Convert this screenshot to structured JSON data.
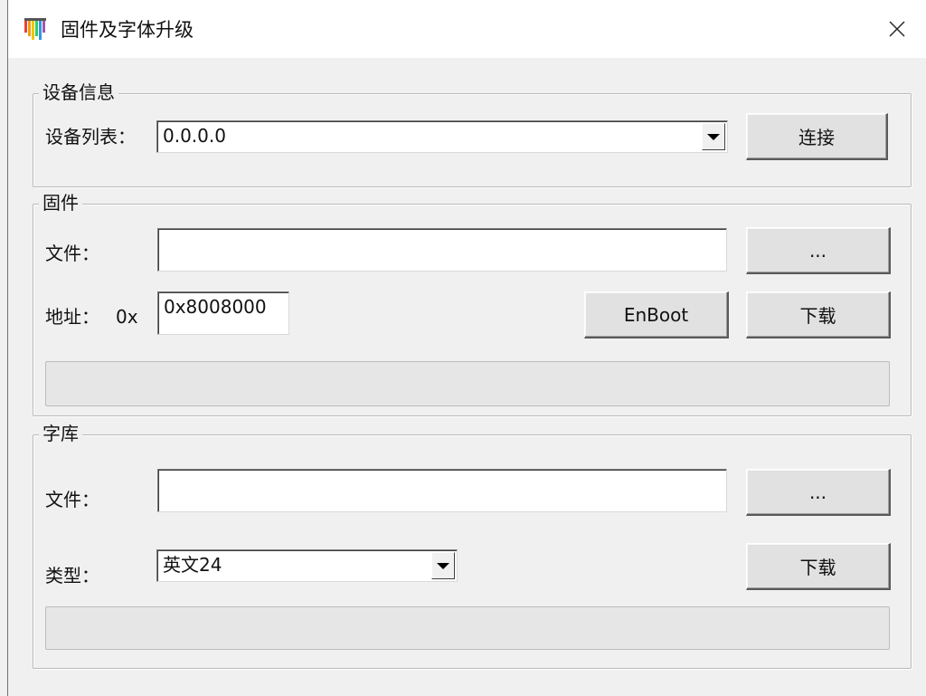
{
  "window": {
    "title": "固件及字体升级",
    "close_symbol": "×"
  },
  "device_info": {
    "legend": "设备信息",
    "list_label": "设备列表：",
    "selected_device": "0.0.0.0",
    "connect_label": "连接"
  },
  "firmware": {
    "legend": "固件",
    "file_label": "文件：",
    "file_value": "",
    "browse_label": "...",
    "address_label": "地址：",
    "address_prefix": "0x",
    "address_value": "0x8008000",
    "enboot_label": "EnBoot",
    "download_label": "下载",
    "progress": 0
  },
  "font_library": {
    "legend": "字库",
    "file_label": "文件：",
    "file_value": "",
    "browse_label": "...",
    "type_label": "类型：",
    "type_value": "英文24",
    "download_label": "下载",
    "progress": 0
  },
  "icons": {
    "app": "wy-logo-icon",
    "close": "close-icon",
    "dropdown": "chevron-down-icon"
  }
}
